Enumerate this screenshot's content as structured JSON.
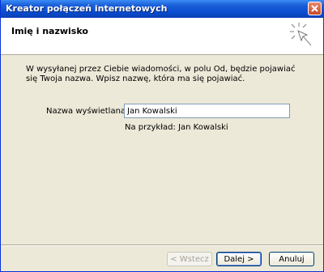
{
  "window": {
    "title": "Kreator połączeń internetowych"
  },
  "header": {
    "title": "Imię i nazwisko"
  },
  "content": {
    "description": "W wysyłanej przez Ciebie wiadomości, w polu Od, będzie pojawiać się Twoja nazwa. Wpisz nazwę, która ma się pojawiać.",
    "display_name_label": "Nazwa wyświetlana:",
    "display_name_value": "Jan Kowalski",
    "example": "Na przykład: Jan Kowalski"
  },
  "buttons": {
    "back": "< Wstecz",
    "next": "Dalej >",
    "cancel": "Anuluj"
  },
  "icons": {
    "close": "close-icon",
    "wizard": "wizard-sparkle-icon"
  }
}
